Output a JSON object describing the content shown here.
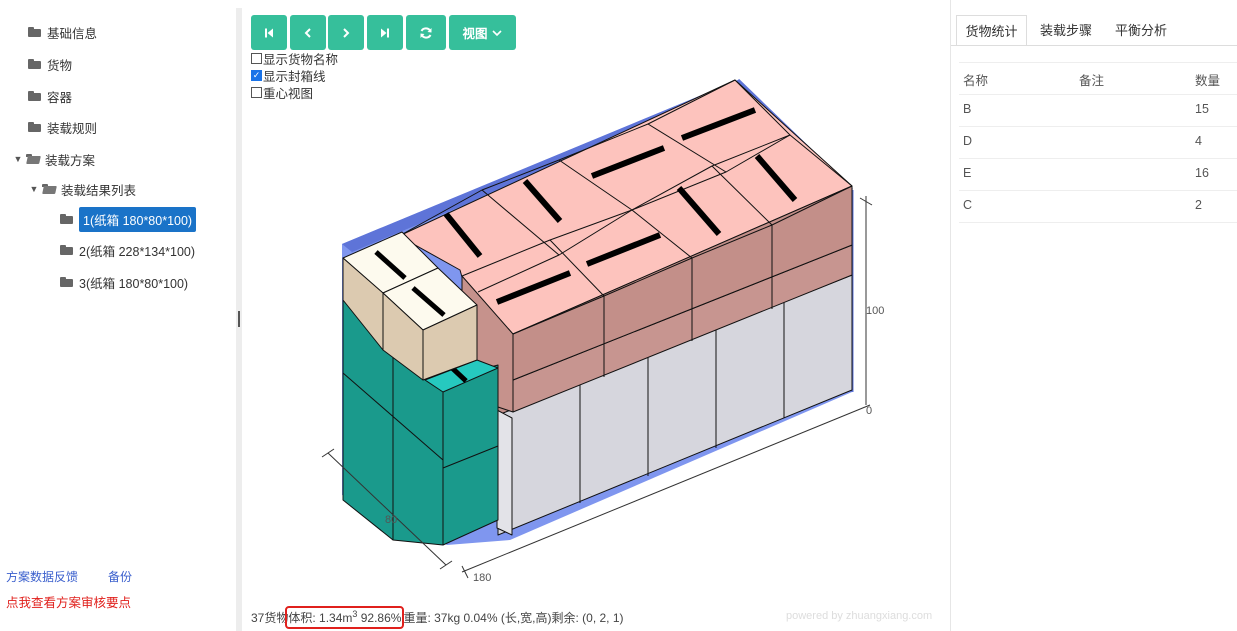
{
  "sidebar": {
    "items": [
      {
        "label": "基础信息"
      },
      {
        "label": "货物"
      },
      {
        "label": "容器"
      },
      {
        "label": "装载规则"
      },
      {
        "label": "装载方案"
      },
      {
        "label": "装载结果列表"
      },
      {
        "label": "1(纸箱 180*80*100)"
      },
      {
        "label": "2(纸箱 228*134*100)"
      },
      {
        "label": "3(纸箱 180*80*100)"
      }
    ],
    "footer": {
      "feedback": "方案数据反馈",
      "backup": "备份",
      "review": "点我查看方案审核要点"
    }
  },
  "toolbar": {
    "view_label": "视图",
    "buttons": [
      "first-icon",
      "prev-icon",
      "next-icon",
      "last-icon",
      "refresh-icon"
    ],
    "accent": "#36bf9b"
  },
  "options": {
    "show_name": {
      "label": "显示货物名称",
      "checked": false
    },
    "show_seal": {
      "label": "显示封箱线",
      "checked": true
    },
    "center_view": {
      "label": "重心视图",
      "checked": false
    }
  },
  "axes": {
    "width_label": "80",
    "length_label": "180",
    "height_top": "100",
    "height_zero": "0"
  },
  "status": {
    "count": "37货物",
    "volume_prefix": "体积: 1.34m",
    "volume_sup": "3",
    "volume_pct": " 92.86%",
    "rest": "重量: 37kg 0.04% (长,宽,高)剩余: (0, 2, 1)"
  },
  "powered": "powered by zhuangxiang.com",
  "right": {
    "tabs": [
      "货物统计",
      "装载步骤",
      "平衡分析"
    ],
    "headers": {
      "name": "名称",
      "note": "备注",
      "qty": "数量"
    },
    "rows": [
      {
        "name": "B",
        "note": "",
        "qty": "15"
      },
      {
        "name": "D",
        "note": "",
        "qty": "4"
      },
      {
        "name": "E",
        "note": "",
        "qty": "16"
      },
      {
        "name": "C",
        "note": "",
        "qty": "2"
      }
    ]
  },
  "colors": {
    "pink_top": "#fdc3bd",
    "pink_side": "#c4908a",
    "teal": "#1a9a8c",
    "teal_top": "#25c8bf",
    "beige_top": "#fdfaee",
    "beige_side": "#dccab0",
    "grey_box": "#d5d5dc",
    "container_edge": "#6a7fdc"
  }
}
